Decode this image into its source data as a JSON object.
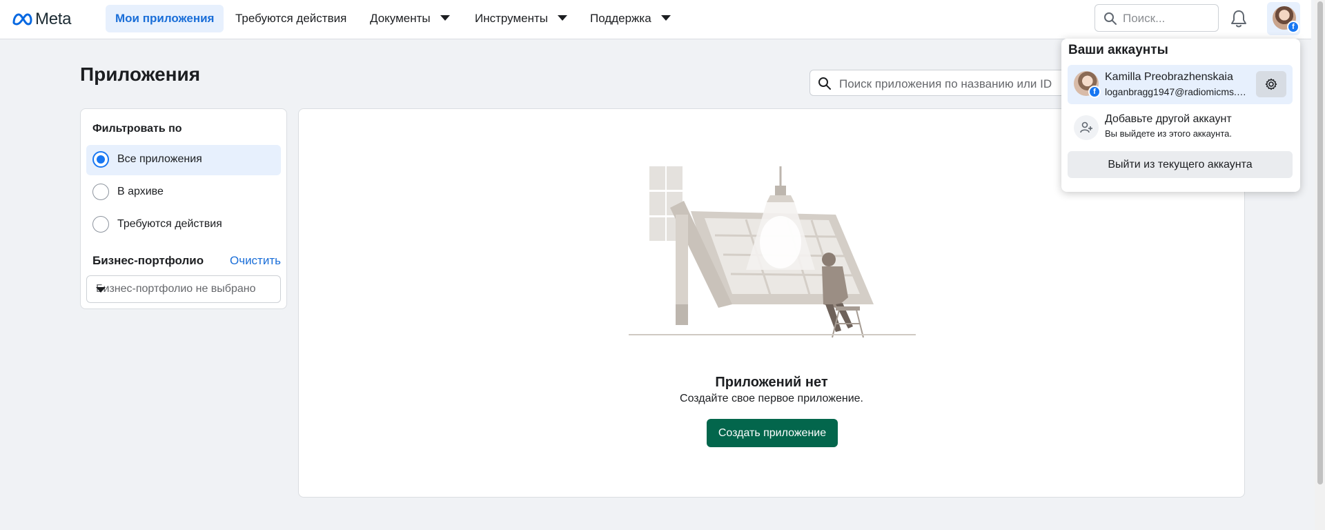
{
  "header": {
    "logo_text": "Meta",
    "nav": {
      "my_apps": "Мои приложения",
      "actions_required": "Требуются действия",
      "docs": "Документы",
      "tools": "Инструменты",
      "support": "Поддержка"
    },
    "search_placeholder": "Поиск..."
  },
  "page": {
    "title": "Приложения",
    "search_placeholder": "Поиск приложения по названию или ID"
  },
  "filter": {
    "title": "Фильтровать по",
    "options": [
      {
        "label": "Все приложения",
        "selected": true
      },
      {
        "label": "В архиве",
        "selected": false
      },
      {
        "label": "Требуются действия",
        "selected": false
      }
    ],
    "business_portfolio_label": "Бизнес-портфолио",
    "clear_label": "Очистить",
    "business_portfolio_value": "Бизнес-портфолио не выбрано"
  },
  "empty_state": {
    "title": "Приложений нет",
    "subtitle": "Создайте свое первое приложение.",
    "create_button": "Создать приложение"
  },
  "accounts_menu": {
    "title": "Ваши аккаунты",
    "account_name": "Kamilla Preobrazhenskaia",
    "account_email": "loganbragg1947@radiomicms.co...",
    "add_account_title": "Добавьте другой аккаунт",
    "add_account_subtitle": "Вы выйдете из этого аккаунта.",
    "logout_button": "Выйти из текущего аккаунта"
  },
  "icons": [
    "meta-logo-icon",
    "search-icon",
    "bell-icon",
    "gear-icon",
    "add-person-icon",
    "facebook-badge-icon"
  ],
  "colors": {
    "accent": "#1877f2",
    "primary_button": "#03664c",
    "active_nav_bg": "#e7f0fd"
  }
}
